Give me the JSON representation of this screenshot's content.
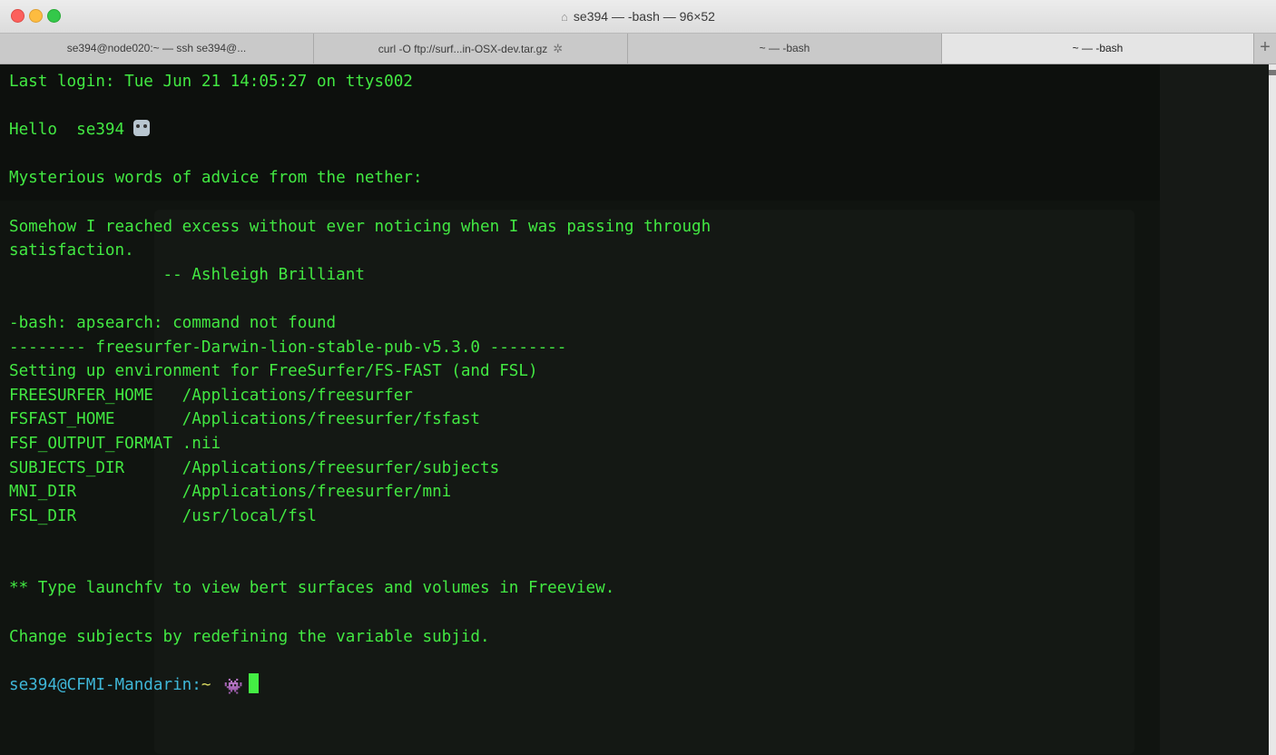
{
  "window": {
    "title": "se394 — -bash — 96×52",
    "home_icon": "home-icon"
  },
  "tabs": [
    {
      "label": "se394@node020:~ — ssh se394@..."
    },
    {
      "label": "curl -O ftp://surf...in-OSX-dev.tar.gz",
      "spinner": "✲"
    },
    {
      "label": "~ — -bash"
    },
    {
      "label": "~ — -bash"
    }
  ],
  "new_tab_label": "+",
  "terminal": {
    "lines": [
      "Last login: Tue Jun 21 14:05:27 on ttys002",
      "",
      "Hello  se394",
      "",
      "Mysterious words of advice from the nether:",
      "",
      "Somehow I reached excess without ever noticing when I was passing through",
      "satisfaction.",
      "                -- Ashleigh Brilliant",
      "",
      "-bash: apsearch: command not found",
      "-------- freesurfer-Darwin-lion-stable-pub-v5.3.0 --------",
      "Setting up environment for FreeSurfer/FS-FAST (and FSL)",
      "FREESURFER_HOME   /Applications/freesurfer",
      "FSFAST_HOME       /Applications/freesurfer/fsfast",
      "FSF_OUTPUT_FORMAT .nii",
      "SUBJECTS_DIR      /Applications/freesurfer/subjects",
      "MNI_DIR           /Applications/freesurfer/mni",
      "FSL_DIR           /usr/local/fsl",
      "",
      "",
      "** Type launchfv to view bert surfaces and volumes in Freeview.",
      "",
      "Change subjects by redefining the variable subjid.",
      ""
    ],
    "prompt": {
      "user_host": "se394@CFMI-Mandarin:",
      "path": "~",
      "icon": "alien-icon"
    },
    "colors": {
      "text": "#42e842",
      "prompt": "#3fb7d8",
      "path": "#d8d860",
      "background": "#101410"
    }
  }
}
